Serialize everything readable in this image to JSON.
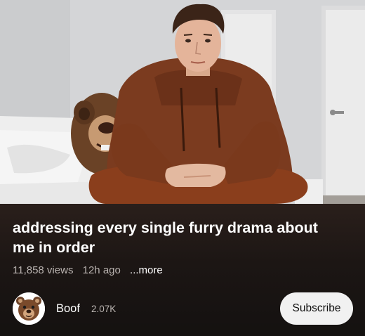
{
  "video": {
    "title": "addressing every single furry drama about me in order",
    "views": "11,858 views",
    "age": "12h ago",
    "more_label": "...more"
  },
  "channel": {
    "name": "Boof",
    "subscribers": "2.07K",
    "avatar_icon": "bear-face-icon"
  },
  "actions": {
    "subscribe_label": "Subscribe"
  },
  "colors": {
    "panel_top": "#2a1f1b",
    "panel_bottom": "#141110",
    "subscribe_bg": "#f1f1f1",
    "hoodie": "#7a3a1e"
  }
}
